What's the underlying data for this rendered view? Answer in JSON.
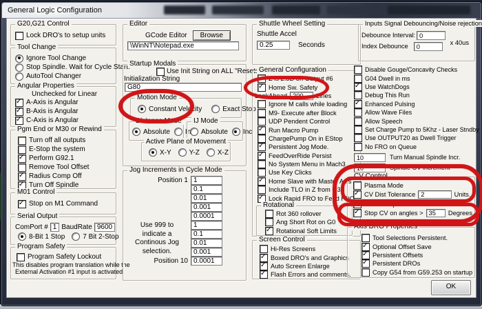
{
  "window": {
    "title": "General Logic Configuration",
    "ok_label": "OK"
  },
  "colors": {
    "annotation": "#d01518"
  },
  "col1": {
    "g20": {
      "title": "G20,G21 Control",
      "items": [
        {
          "label": "Lock DRO's to setup units",
          "checked": false
        }
      ]
    },
    "tool_change": {
      "title": "Tool Change",
      "radios": [
        {
          "label": "Ignore Tool Change",
          "selected": true
        },
        {
          "label": "Stop Spindle. Wait for Cycle Start.",
          "selected": false
        },
        {
          "label": "AutoTool Changer",
          "selected": false
        }
      ]
    },
    "angular": {
      "title": "Angular Properties",
      "note": "Unchecked for Linear",
      "items": [
        {
          "label": "A-Axis is Angular",
          "checked": true
        },
        {
          "label": "B-Axis is Angular",
          "checked": true
        },
        {
          "label": "C-Axis is Angular",
          "checked": true
        }
      ]
    },
    "pgm_end": {
      "title": "Pgm End or M30 or Rewind",
      "items": [
        {
          "label": "Turn off all outputs",
          "checked": false
        },
        {
          "label": "E-Stop the system",
          "checked": false
        },
        {
          "label": "Perform G92.1",
          "checked": true
        },
        {
          "label": "Remove Tool Offset",
          "checked": false
        },
        {
          "label": "Radius Comp Off",
          "checked": true
        },
        {
          "label": "Turn Off Spindle",
          "checked": true
        }
      ]
    },
    "m01": {
      "title": "M01 Control",
      "items": [
        {
          "label": "Stop on M1 Command",
          "checked": true
        }
      ]
    },
    "serial": {
      "title": "Serial Output",
      "comport_label": "ComPort #",
      "comport_value": "1",
      "baud_label": "BaudRate",
      "baud_value": "9600",
      "radios": [
        {
          "label": "8-Bit 1 Stop",
          "selected": true
        },
        {
          "label": "7 Bit 2-Stop",
          "selected": false
        }
      ]
    },
    "program_safety": {
      "title": "Program Safety",
      "items": [
        {
          "label": "Program Safety Lockout",
          "checked": false
        }
      ],
      "note1": "This disables program translation while the",
      "note2": "External Activation #1 input is activated."
    }
  },
  "col2": {
    "editor": {
      "title": "Editor",
      "gcode_label": "GCode Editor",
      "browse_label": "Browse",
      "path_value": "\\WinNT\\Notepad.exe"
    },
    "startup": {
      "title": "Startup Modals",
      "init_check": {
        "label": "Use Init String on ALL  \"Resets\"",
        "checked": false
      },
      "init_label": "Initialization String",
      "init_value": "G80",
      "motion_mode": {
        "title": "Motion Mode",
        "radios": [
          {
            "label": "Constant Velocity",
            "selected": true
          },
          {
            "label": "Exact Stop",
            "selected": false
          }
        ]
      },
      "distance_mode": {
        "title": "Distance Mode",
        "radios": [
          {
            "label": "Absolute",
            "selected": true
          },
          {
            "label": "Inc",
            "selected": false
          }
        ]
      },
      "ij_mode": {
        "title": "IJ Mode",
        "radios": [
          {
            "label": "Absolute",
            "selected": false
          },
          {
            "label": "Inc",
            "selected": true
          }
        ]
      },
      "active_plane": {
        "title": "Active Plane of Movement",
        "radios": [
          {
            "label": "X-Y",
            "selected": true
          },
          {
            "label": "Y-Z",
            "selected": false
          },
          {
            "label": "X-Z",
            "selected": false
          }
        ]
      }
    },
    "jog": {
      "title": "Jog Increments in Cycle Mode",
      "note_lines": [
        "Use 999 to",
        "indicate a",
        "Continous Jog",
        "selection."
      ],
      "rows": [
        {
          "label": "Position 1",
          "value": "1"
        },
        {
          "label": "",
          "value": "0.1"
        },
        {
          "label": "",
          "value": "0.01"
        },
        {
          "label": "",
          "value": "0.001"
        },
        {
          "label": "",
          "value": "0.0001"
        },
        {
          "label": "",
          "value": "1"
        },
        {
          "label": "",
          "value": "0.1"
        },
        {
          "label": "",
          "value": "0.01"
        },
        {
          "label": "",
          "value": "0.001"
        },
        {
          "label": "Position 10",
          "value": "0.0001"
        }
      ]
    }
  },
  "col3": {
    "shuttle": {
      "title": "Shuttle Wheel Setting",
      "accel_label": "Shuttle Accel",
      "accel_value": "0.25",
      "unit": "Seconds"
    },
    "general": {
      "title": "General Configuration",
      "items_top": [
        {
          "label": "Z is 2.5D on Output #6",
          "checked": false
        },
        {
          "label": "Home Sw. Safety",
          "checked": true
        }
      ],
      "lookahead": {
        "label": "LookAhead",
        "value": "200",
        "unit": "Lines"
      },
      "items_bottom": [
        {
          "label": "Ignore M calls while loading",
          "checked": false
        },
        {
          "label": "M9- Execute after Block",
          "checked": false
        },
        {
          "label": "UDP Pendent Control",
          "checked": false
        },
        {
          "label": "Run Macro Pump",
          "checked": true
        },
        {
          "label": "ChargePump On in EStop",
          "checked": false
        },
        {
          "label": "Persistent Jog Mode.",
          "checked": true
        },
        {
          "label": "FeedOverRide Persist",
          "checked": true
        },
        {
          "label": "No System Menu in Mach3",
          "checked": false
        },
        {
          "label": "Use Key Clicks",
          "checked": false
        },
        {
          "label": "Home Slave with Master Axis",
          "checked": true
        },
        {
          "label": "Include TLO in Z from G31",
          "checked": false
        },
        {
          "label": "Lock Rapid FRO to Feed FRO",
          "checked": true
        }
      ],
      "rotational": {
        "title": "Rotational",
        "items": [
          {
            "label": "Rot 360 rollover",
            "checked": false
          },
          {
            "label": "Ang Short Rot on G0",
            "checked": false
          },
          {
            "label": "Rotational Soft Limits",
            "checked": true
          }
        ]
      }
    },
    "screen": {
      "title": "Screen Control",
      "items": [
        {
          "label": "Hi-Res Screens",
          "checked": false
        },
        {
          "label": "Boxed DRO's and Graphics",
          "checked": true
        },
        {
          "label": "Auto Screen Enlarge",
          "checked": true
        },
        {
          "label": "Flash Errors and comments.",
          "checked": true
        }
      ]
    }
  },
  "col4": {
    "debounce": {
      "title": "Inputs Signal Debouncing/Noise rejection",
      "interval_label": "Debounce Interval:",
      "interval_value": "0",
      "index_label": "Index Debounce",
      "index_value": "0",
      "unit": "x 40us"
    },
    "options": {
      "items": [
        {
          "label": "Disable Gouge/Concavity Checks",
          "checked": false
        },
        {
          "label": "G04 Dwell in ms",
          "checked": false
        },
        {
          "label": "Use WatchDogs",
          "checked": true
        },
        {
          "label": "Debug This Run",
          "checked": false
        },
        {
          "label": "Enhanced Pulsing",
          "checked": true
        },
        {
          "label": "Allow Wave Files",
          "checked": false
        },
        {
          "label": "Allow Speech",
          "checked": false
        },
        {
          "label": "Set Charge Pump to 5Khz  - Laser Stndby",
          "checked": false
        },
        {
          "label": "Use OUTPUT20 as Dwell Trigger",
          "checked": false
        },
        {
          "label": "No FRO on Queue",
          "checked": false
        }
      ],
      "spindle_incr": {
        "value": "10",
        "label": "Turn Manual Spindle Incr."
      },
      "spindle_ov": {
        "value": "10",
        "label": "Spindle OV increment"
      }
    },
    "cv": {
      "title": "CV Control",
      "plasma": {
        "label": "Plasma Mode",
        "checked": false
      },
      "dist_tol": {
        "label": "CV Dist Tolerance",
        "checked": true,
        "value": "2",
        "unit": "Units.."
      },
      "g100": {
        "label": "G100 Adaptive NurbsCV",
        "checked": false
      },
      "stop_cv": {
        "label": "Stop CV on angles >",
        "checked": true,
        "value": "35",
        "unit": "Degrees"
      }
    },
    "axis_dro": {
      "title": "Axis DRO Properties",
      "items": [
        {
          "label": "Tool Selections Persistent.",
          "checked": false
        },
        {
          "label": "Optional Offset Save",
          "checked": true
        },
        {
          "label": "Persistent Offsets",
          "checked": true
        },
        {
          "label": "Persistent DROs",
          "checked": true
        },
        {
          "label": "Copy G54 from G59.253 on startup",
          "checked": false
        }
      ]
    }
  }
}
